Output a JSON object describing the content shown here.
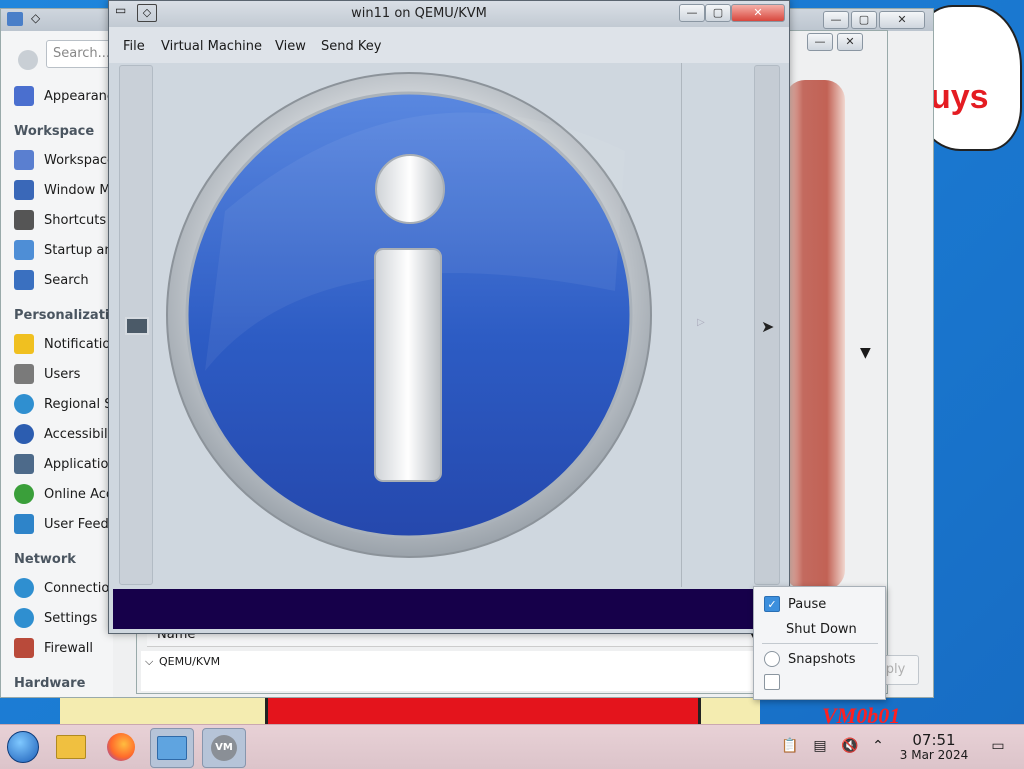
{
  "console": {
    "title": "win11 on QEMU/KVM",
    "menu": [
      "File",
      "Virtual Machine",
      "View",
      "Send Key"
    ]
  },
  "settings": {
    "search_placeholder": "Search...",
    "items": [
      {
        "label": "Appearance",
        "icon": "appearance-icon",
        "color": "#4a6fcf"
      },
      {
        "label": "Workspace",
        "icon": "workspace-icon",
        "color": "#5a7fd0"
      },
      {
        "label": "Window Ma",
        "icon": "window-management-icon",
        "color": "#3a68b8"
      },
      {
        "label": "Shortcuts",
        "icon": "keyboard-icon",
        "color": "#555555"
      },
      {
        "label": "Startup and",
        "icon": "startup-icon",
        "color": "#4e8ed6"
      },
      {
        "label": "Search",
        "icon": "search-icon",
        "color": "#3a70c0"
      },
      {
        "label": "Notification",
        "icon": "bell-icon",
        "color": "#f0c020"
      },
      {
        "label": "Users",
        "icon": "users-icon",
        "color": "#7a7a7a"
      },
      {
        "label": "Regional Se",
        "icon": "globe-icon",
        "color": "#2f8fd0"
      },
      {
        "label": "Accessibility",
        "icon": "accessibility-icon",
        "color": "#2c5db0"
      },
      {
        "label": "Application",
        "icon": "applications-icon",
        "color": "#4d6a8a"
      },
      {
        "label": "Online Acco",
        "icon": "online-accounts-icon",
        "color": "#3a9f3a"
      },
      {
        "label": "User Feedb",
        "icon": "feedback-icon",
        "color": "#2e84c9"
      },
      {
        "label": "Connection",
        "icon": "connections-icon",
        "color": "#2f8fd0"
      },
      {
        "label": "Settings",
        "icon": "network-settings-icon",
        "color": "#2f8fd0"
      },
      {
        "label": "Firewall",
        "icon": "firewall-icon",
        "color": "#b94a3a"
      }
    ],
    "sections": [
      "Workspace",
      "Personalization",
      "Network",
      "Hardware"
    ]
  },
  "vm_manager": {
    "column_name": "Name",
    "group": "QEMU/KVM",
    "apply_label": "Apply"
  },
  "popup": {
    "pause": "Pause",
    "shutdown": "Shut Down",
    "snapshots": "Snapshots",
    "pause_checked": true
  },
  "desktop": {
    "bubble_text": "uys",
    "watermark": "VM0b01"
  },
  "taskbar": {
    "time": "07:51",
    "date": "3 Mar 2024",
    "apps": [
      "start-menu-icon",
      "file-manager-icon",
      "firefox-icon",
      "system-settings-icon",
      "virt-manager-icon"
    ]
  },
  "colors": {
    "info_blue": "#2d5cc4",
    "console_status_bg": "#16004a",
    "wallpaper": "#1a78d0"
  }
}
